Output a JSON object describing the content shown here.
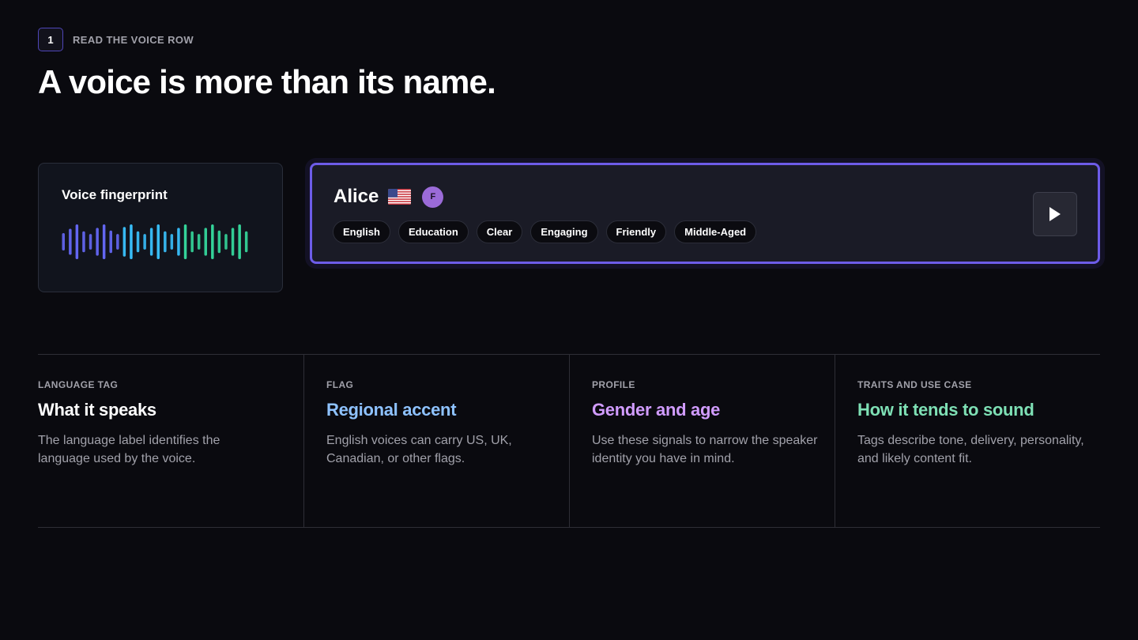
{
  "step": {
    "number": "1",
    "label": "READ THE VOICE ROW"
  },
  "headline": "A voice is more than its name.",
  "fingerprint": {
    "title": "Voice fingerprint",
    "wave_levels": [
      0.5,
      0.75,
      1.0,
      0.6,
      0.45,
      0.8,
      1.0,
      0.65,
      0.45,
      0.85,
      1.0,
      0.6,
      0.45,
      0.8,
      1.0,
      0.6,
      0.45,
      0.8,
      1.0,
      0.6,
      0.45,
      0.8,
      1.0,
      0.65,
      0.45,
      0.8,
      1.0,
      0.6
    ],
    "colors": {
      "start": "#6366f1",
      "mid": "#38bdf8",
      "end": "#34d399"
    }
  },
  "voice": {
    "name": "Alice",
    "flag": "us-flag-icon",
    "gender_badge": "F",
    "tags": [
      "English",
      "Education",
      "Clear",
      "Engaging",
      "Friendly",
      "Middle-Aged"
    ],
    "play_icon": "play-icon"
  },
  "columns": [
    {
      "label": "LANGUAGE TAG",
      "title": "What it speaks",
      "title_color": "#ffffff",
      "desc": "The language label identifies the language used by the voice."
    },
    {
      "label": "FLAG",
      "title": "Regional accent",
      "title_color": "#8ec2ff",
      "desc": "English voices can carry US, UK, Canadian, or other flags."
    },
    {
      "label": "PROFILE",
      "title": "Gender and age",
      "title_color": "#d19cff",
      "desc": "Use these signals to narrow the speaker identity you have in mind."
    },
    {
      "label": "TRAITS AND USE CASE",
      "title": "How it tends to sound",
      "title_color": "#7ee0b5",
      "desc": "Tags describe tone, delivery, personality, and likely content fit."
    }
  ]
}
